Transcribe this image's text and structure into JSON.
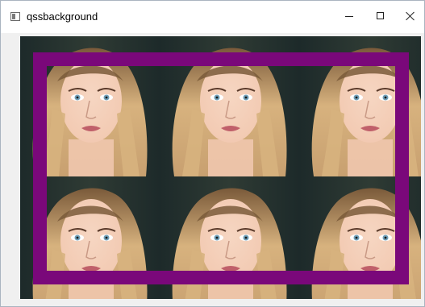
{
  "window": {
    "title": "qssbackground"
  },
  "icons": {
    "app": "app-window-icon",
    "minimize": "minimize-icon",
    "maximize": "maximize-icon",
    "close": "close-icon"
  },
  "colors": {
    "frame_border": "#7a087a",
    "hair_light": "#d7b27e",
    "hair_dark": "#7a5a3a",
    "skin": "#f2c9b1",
    "eyes": "#6f9fb8",
    "background_dark": "#1d2a2a"
  }
}
